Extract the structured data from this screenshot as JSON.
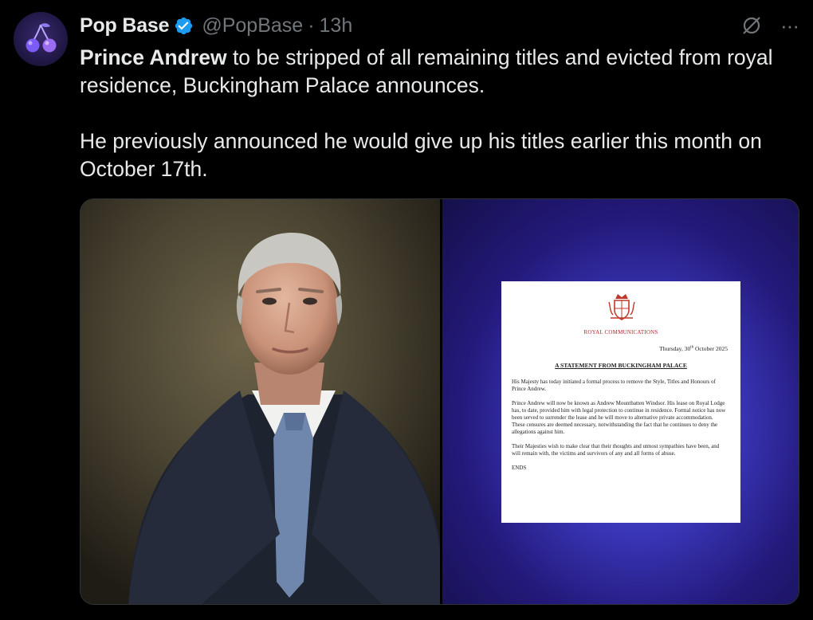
{
  "tweet": {
    "display_name": "Pop Base",
    "handle": "@PopBase",
    "separator": "·",
    "time": "13h",
    "text_bold": "Prince Andrew",
    "text_rest": " to be stripped of all remaining titles and evicted from royal residence, Buckingham Palace announces.",
    "text_para2": "He previously announced he would give up his titles earlier this month on October 17th."
  },
  "icons": {
    "verified": "verified-badge-icon",
    "grok": "grok-icon",
    "more": "more-icon",
    "more_glyph": "···"
  },
  "colors": {
    "background": "#000000",
    "text": "#e7e9ea",
    "muted": "#71767b",
    "verified": "#1d9bf0"
  },
  "document": {
    "org": "ROYAL COMMUNICATIONS",
    "date_prefix": "Thursday, 30",
    "date_sup": "th",
    "date_suffix": " October 2025",
    "title": "A STATEMENT FROM BUCKINGHAM PALACE",
    "para1": "His Majesty has today initiated a formal process to remove the Style, Titles and Honours of Prince Andrew.",
    "para2": "Prince Andrew will now be known as Andrew Mountbatten Windsor. His lease on Royal Lodge has, to date, provided him with legal protection to continue in residence. Formal notice has now been served to surrender the lease and he will move to alternative private accommodation. These censures are deemed necessary, notwithstanding the fact that he continues to deny the allegations against him.",
    "para3": "Their Majesties wish to make clear that their thoughts and utmost sympathies have been, and will remain with, the victims and survivors of any and all forms of abuse.",
    "ends": "ENDS"
  }
}
